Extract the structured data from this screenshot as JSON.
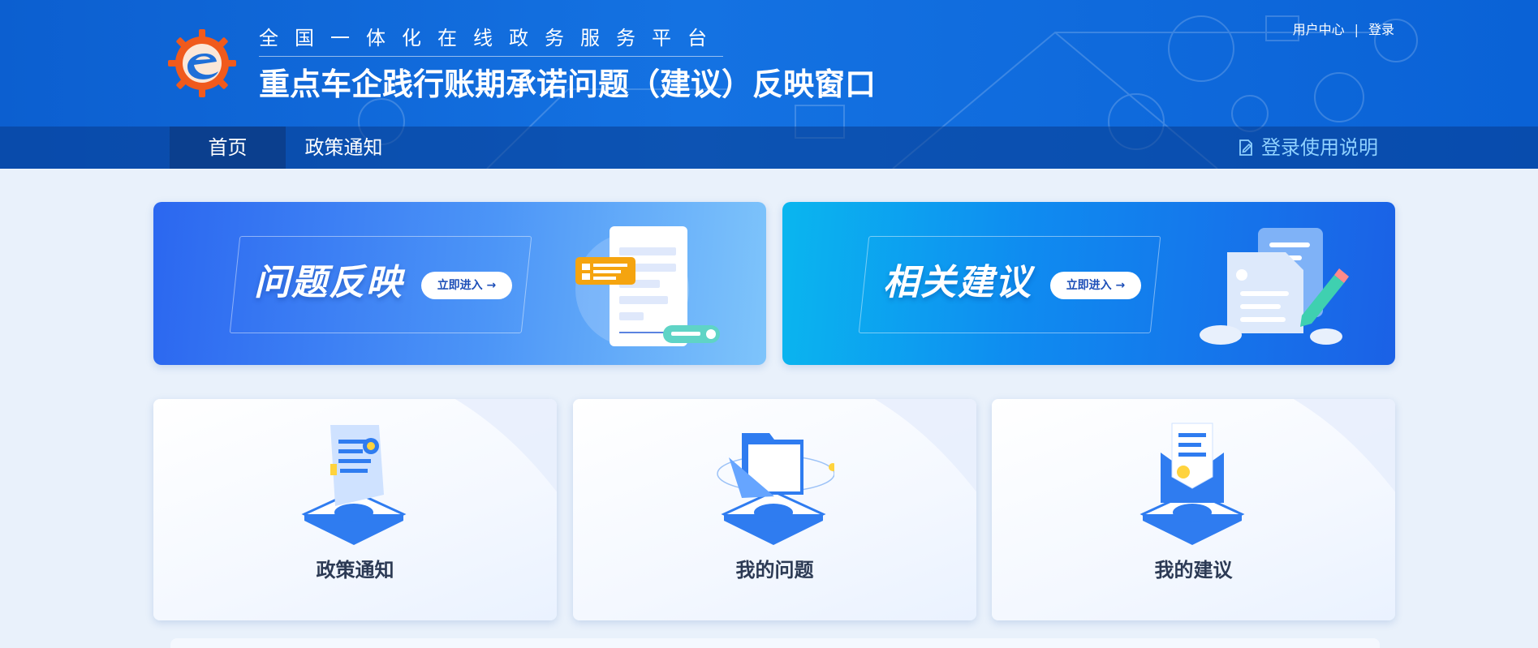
{
  "header": {
    "subtitle": "全国一体化在线政务服务平台",
    "title": "重点车企践行账期承诺问题（建议）反映窗口",
    "user_center": "用户中心",
    "separator": "|",
    "login": "登录"
  },
  "nav": {
    "items": [
      {
        "label": "首页",
        "active": true
      },
      {
        "label": "政策通知",
        "active": false
      }
    ],
    "help_label": "登录使用说明"
  },
  "banners": [
    {
      "title": "问题反映",
      "button": "立即进入 →"
    },
    {
      "title": "相关建议",
      "button": "立即进入 →"
    }
  ],
  "cards": [
    {
      "label": "政策通知",
      "icon": "policy-document-icon"
    },
    {
      "label": "我的问题",
      "icon": "folder-icon"
    },
    {
      "label": "我的建议",
      "icon": "envelope-icon"
    }
  ],
  "colors": {
    "header_blue": "#1472e2",
    "nav_active": "#0b3f8e",
    "help_text": "#8fd1ff",
    "page_bg": "#e9f1fb",
    "card_text": "#2c3a54"
  }
}
